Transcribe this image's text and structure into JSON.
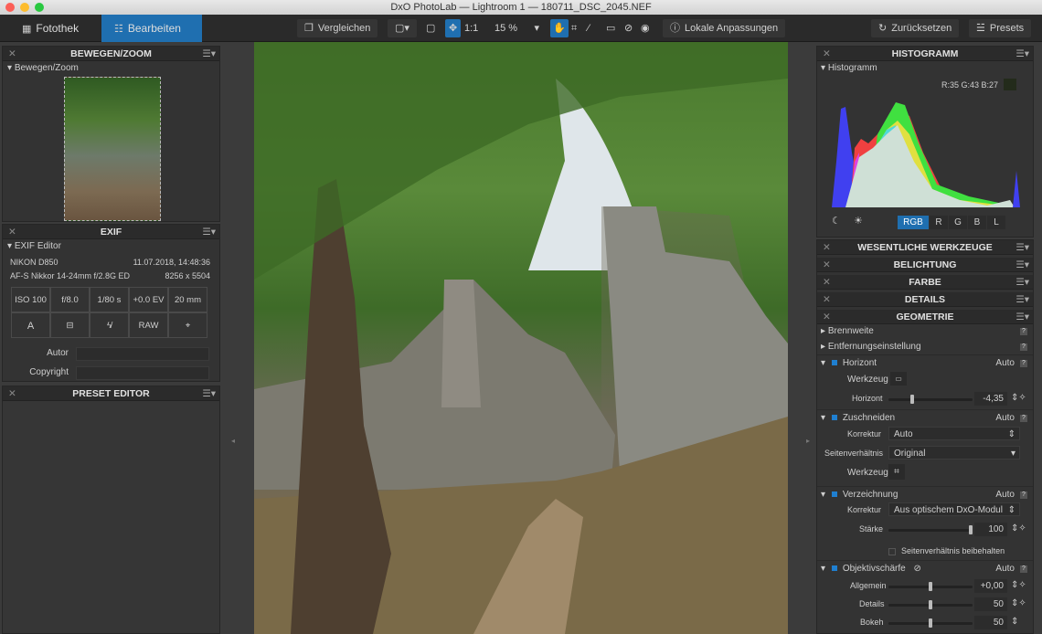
{
  "window": {
    "title": "DxO PhotoLab — Lightroom 1 — 180711_DSC_2045.NEF"
  },
  "toolbar": {
    "tabs": [
      "Fotothek",
      "Bearbeiten"
    ],
    "compare": "Vergleichen",
    "one_to_one": "1:1",
    "zoom": "15 %",
    "local_adjust": "Lokale Anpassungen",
    "reset": "Zurücksetzen",
    "presets": "Presets"
  },
  "left": {
    "move_zoom": {
      "title": "BEWEGEN/ZOOM",
      "sub": "Bewegen/Zoom"
    },
    "exif": {
      "title": "EXIF",
      "sub": "EXIF Editor",
      "camera": "NIKON D850",
      "date": "11.07.2018, 14:48:36",
      "lens": "AF-S Nikkor 14-24mm f/2.8G ED",
      "size": "8256 x 5504",
      "cells": [
        "ISO 100",
        "f/8.0",
        "1/80 s",
        "+0.0 EV",
        "20 mm"
      ],
      "mode": "A",
      "raw": "RAW",
      "author_label": "Autor",
      "copyright_label": "Copyright"
    },
    "preset_editor": {
      "title": "PRESET EDITOR"
    }
  },
  "right": {
    "histogram": {
      "title": "HISTOGRAMM",
      "sub": "Histogramm",
      "readout": "R:35 G:43 B:27",
      "swatch": "#232b1b",
      "channels": [
        "RGB",
        "R",
        "G",
        "B",
        "L"
      ]
    },
    "sections": [
      "WESENTLICHE WERKZEUGE",
      "BELICHTUNG",
      "FARBE",
      "DETAILS",
      "GEOMETRIE"
    ],
    "geo": {
      "brennweite": "Brennweite",
      "entfernung": "Entfernungseinstellung",
      "auto": "Auto",
      "horizont": {
        "title": "Horizont",
        "tool": "Werkzeug",
        "slider_label": "Horizont",
        "value": "-4,35",
        "pos": 0.28
      },
      "crop": {
        "title": "Zuschneiden",
        "korrektur": "Korrektur",
        "korrektur_val": "Auto",
        "ratio": "Seitenverhältnis",
        "ratio_val": "Original",
        "tool": "Werkzeug"
      },
      "distort": {
        "title": "Verzeichnung",
        "korrektur": "Korrektur",
        "korrektur_val": "Aus optischem DxO-Modul",
        "strength": "Stärke",
        "value": "100",
        "pos": 0.98,
        "keep_ratio": "Seitenverhältnis beibehalten"
      },
      "sharp": {
        "title": "Objektivschärfe",
        "rows": [
          {
            "label": "Allgemein",
            "value": "+0,00",
            "pos": 0.5
          },
          {
            "label": "Details",
            "value": "50",
            "pos": 0.5
          },
          {
            "label": "Bokeh",
            "value": "50",
            "pos": 0.5
          }
        ]
      }
    }
  },
  "colors": {
    "accent": "#1f6fb0"
  }
}
